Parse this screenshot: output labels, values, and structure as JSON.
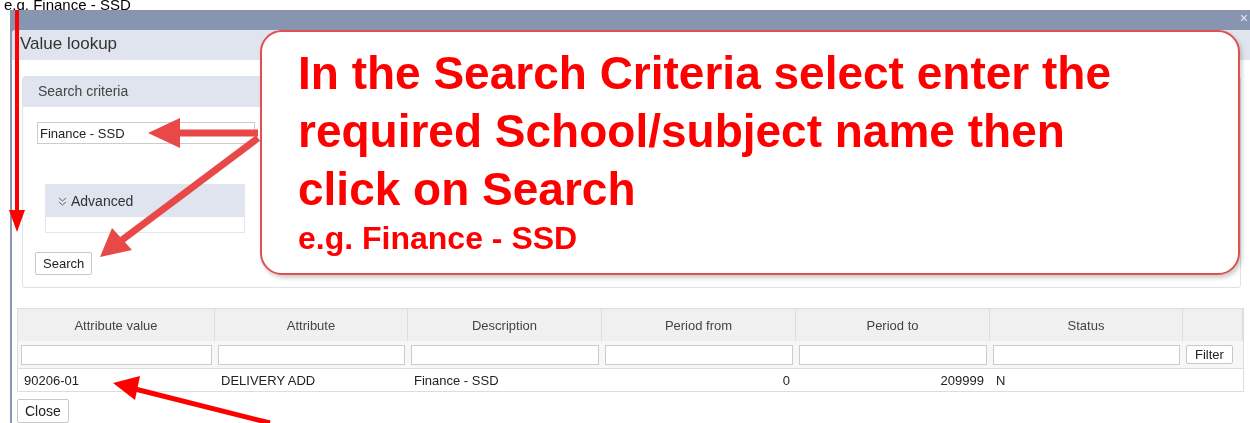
{
  "top_caption": "e.g. Finance - SSD",
  "window": {
    "title": "Value lookup",
    "close": "×"
  },
  "search_criteria": {
    "title": "Search criteria",
    "field_value": "Finance - SSD",
    "advanced": "Advanced",
    "search_button": "Search"
  },
  "table": {
    "columns": [
      "Attribute value",
      "Attribute",
      "Description",
      "Period from",
      "Period to",
      "Status"
    ],
    "filter_button": "Filter",
    "rows": [
      {
        "cells": [
          "90206-01",
          "DELIVERY ADD",
          "Finance - SSD",
          "0",
          "209999",
          "N"
        ]
      }
    ]
  },
  "close_button": "Close",
  "callout": {
    "instruction": "In the Search Criteria select enter the required School/subject name then click on Search",
    "example": "e.g. Finance - SSD"
  }
}
